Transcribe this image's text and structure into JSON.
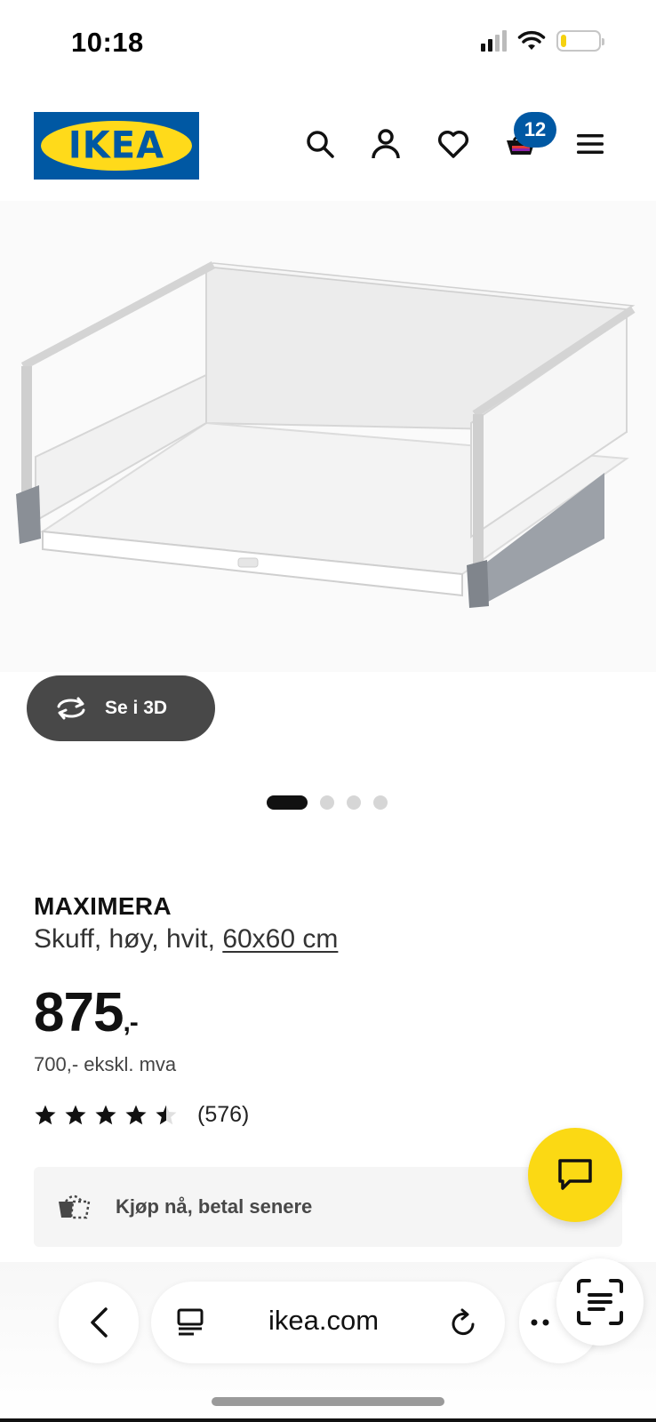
{
  "status_bar": {
    "time": "10:18",
    "battery_level": 0.15,
    "battery_color": "#f5d10f"
  },
  "header": {
    "logo_text": "IKEA",
    "logo_colors": {
      "blue": "#0058a3",
      "yellow": "#ffda1a"
    },
    "icons": [
      "search-icon",
      "account-icon",
      "heart-icon",
      "cart-icon",
      "menu-icon"
    ],
    "cart_count": "12"
  },
  "hero": {
    "view_3d_label": "Se i 3D",
    "gallery_total": 4,
    "gallery_active": 1
  },
  "product": {
    "name": "MAXIMERA",
    "description_prefix": "Skuff, høy, hvit, ",
    "dimensions": "60x60 cm",
    "price": "875",
    "price_suffix": ",-",
    "price_ex_vat": "700,- ekskl. mva",
    "rating": 4.5,
    "rating_count": "(576)"
  },
  "payment": {
    "label": "Kjøp nå, betal senere"
  },
  "chat": {
    "icon": "chat-icon",
    "color": "#fbd914"
  },
  "browser": {
    "url": "ikea.com",
    "icons": [
      "back-icon",
      "tabs-icon",
      "reload-icon",
      "more-icon",
      "text-scan-icon"
    ]
  }
}
